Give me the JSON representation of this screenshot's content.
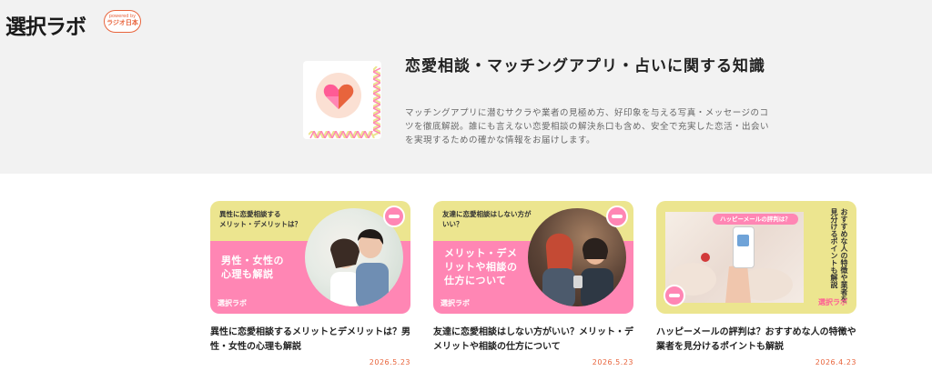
{
  "header": {
    "logo": "選択ラボ",
    "powered_by": "powered by",
    "powered_brand": "ラジオ日本"
  },
  "hero": {
    "icon": "heart-icon",
    "title": "恋愛相談・マッチングアプリ・占いに関する知識",
    "description": "マッチングアプリに潜むサクラや業者の見極め方、好印象を与える写真・メッセージのコツを徹底解説。誰にも言えない恋愛相談の解決糸口も含め、安全で充実した恋活・出会いを実現するための確かな情報をお届けします。"
  },
  "articles": [
    {
      "thumb_top": "異性に恋愛相談する\nメリット・デメリットは？",
      "thumb_main": "男性・女性の\n心理も解説",
      "thumb_logo": "選択ラボ",
      "title": "異性に恋愛相談するメリットとデメリットは？男性・女性の心理も解説",
      "date": "2026.5.23"
    },
    {
      "thumb_top": "友達に恋愛相談はしない方が\nいい？",
      "thumb_main": "メリット・デメ\nリットや相談の\n仕方について",
      "thumb_logo": "選択ラボ",
      "title": "友達に恋愛相談はしない方がいい？メリット・デメリットや相談の仕方について",
      "date": "2026.5.23"
    },
    {
      "thumb_pill": "ハッピーメールの評判は？",
      "thumb_vertical": "おすすめな人の特徴や業者を見分けるポイントも解説",
      "thumb_logo": "選択ラボ",
      "title": "ハッピーメールの評判は？おすすめな人の特徴や業者を見分けるポイントも解説",
      "date": "2026.4.23"
    }
  ],
  "colors": {
    "accent": "#e8643c",
    "pink": "#ff86b4",
    "yellow": "#ece58f",
    "hero_bg": "#f2f2f2"
  }
}
